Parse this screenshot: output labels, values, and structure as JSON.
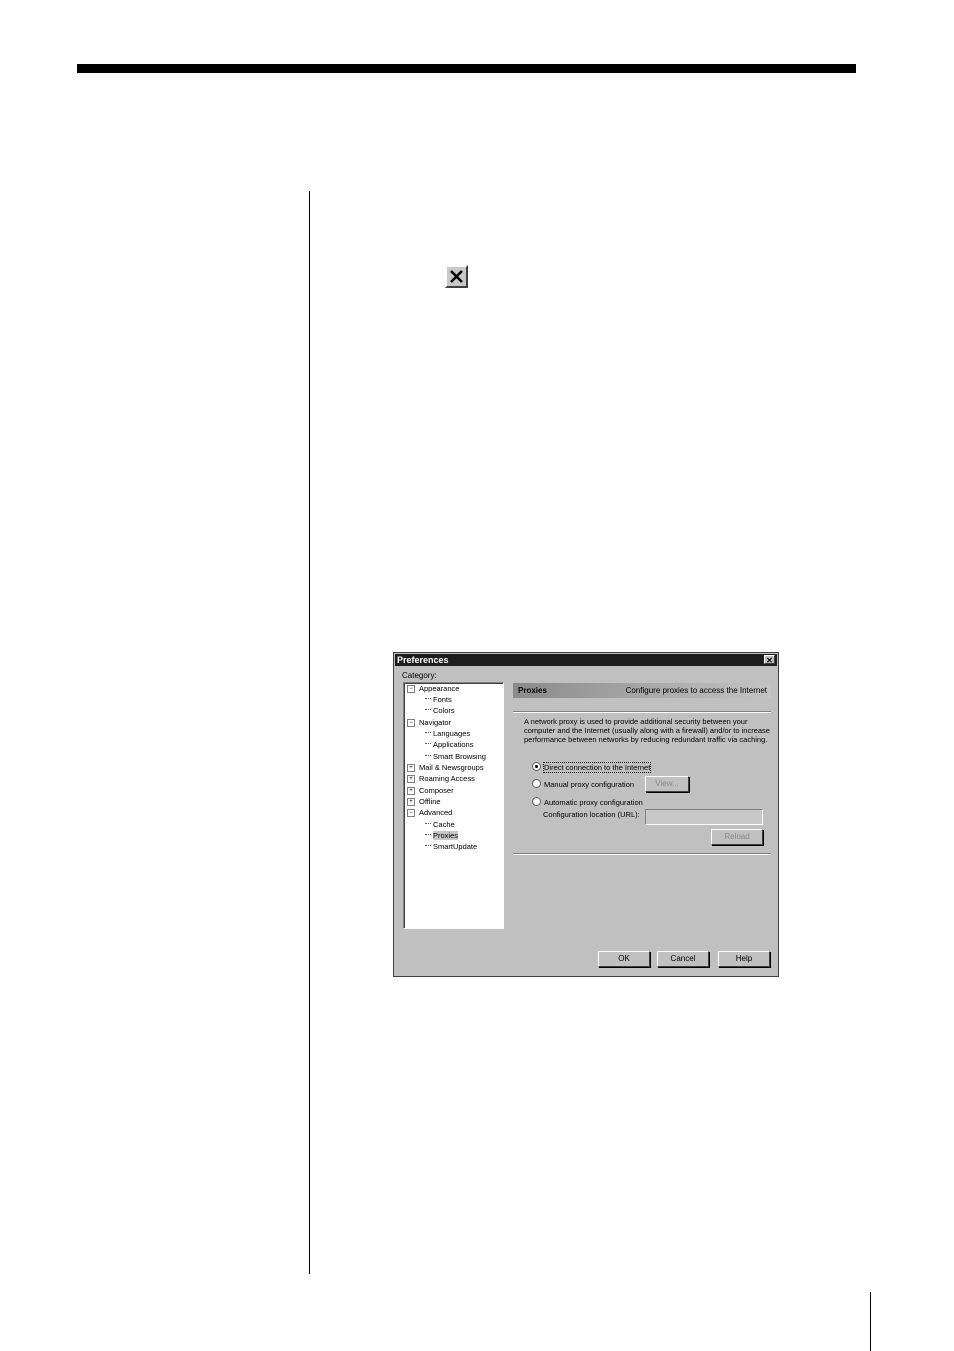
{
  "dialog": {
    "title": "Preferences",
    "close_glyph": "✕",
    "category_label": "Category:",
    "tree": [
      {
        "label": "Appearance",
        "expander": "−"
      },
      {
        "label": "Fonts"
      },
      {
        "label": "Colors"
      },
      {
        "label": "Navigator",
        "expander": "−"
      },
      {
        "label": "Languages"
      },
      {
        "label": "Applications"
      },
      {
        "label": "Smart Browsing"
      },
      {
        "label": "Mail & Newsgroups",
        "expander": "+"
      },
      {
        "label": "Roaming Access",
        "expander": "+"
      },
      {
        "label": "Composer",
        "expander": "+"
      },
      {
        "label": "Offline",
        "expander": "+"
      },
      {
        "label": "Advanced",
        "expander": "−"
      },
      {
        "label": "Cache"
      },
      {
        "label": "Proxies",
        "selected": true
      },
      {
        "label": "SmartUpdate"
      }
    ],
    "panel": {
      "title": "Proxies",
      "subtitle": "Configure proxies to access the Internet",
      "description": "A network proxy is used to provide additional security between your computer and the Internet (usually along with a firewall) and/or to increase performance between networks by reducing redundant traffic via caching.",
      "options": [
        {
          "label": "Direct connection to the Internet",
          "selected": true
        },
        {
          "label": "Manual proxy configuration",
          "selected": false
        },
        {
          "label": "Automatic proxy configuration",
          "selected": false
        }
      ],
      "view_button": "View...",
      "config_url_label": "Configuration location (URL):",
      "config_url_value": "",
      "reload_button": "Reload"
    },
    "buttons": {
      "ok": "OK",
      "cancel": "Cancel",
      "help": "Help"
    }
  }
}
